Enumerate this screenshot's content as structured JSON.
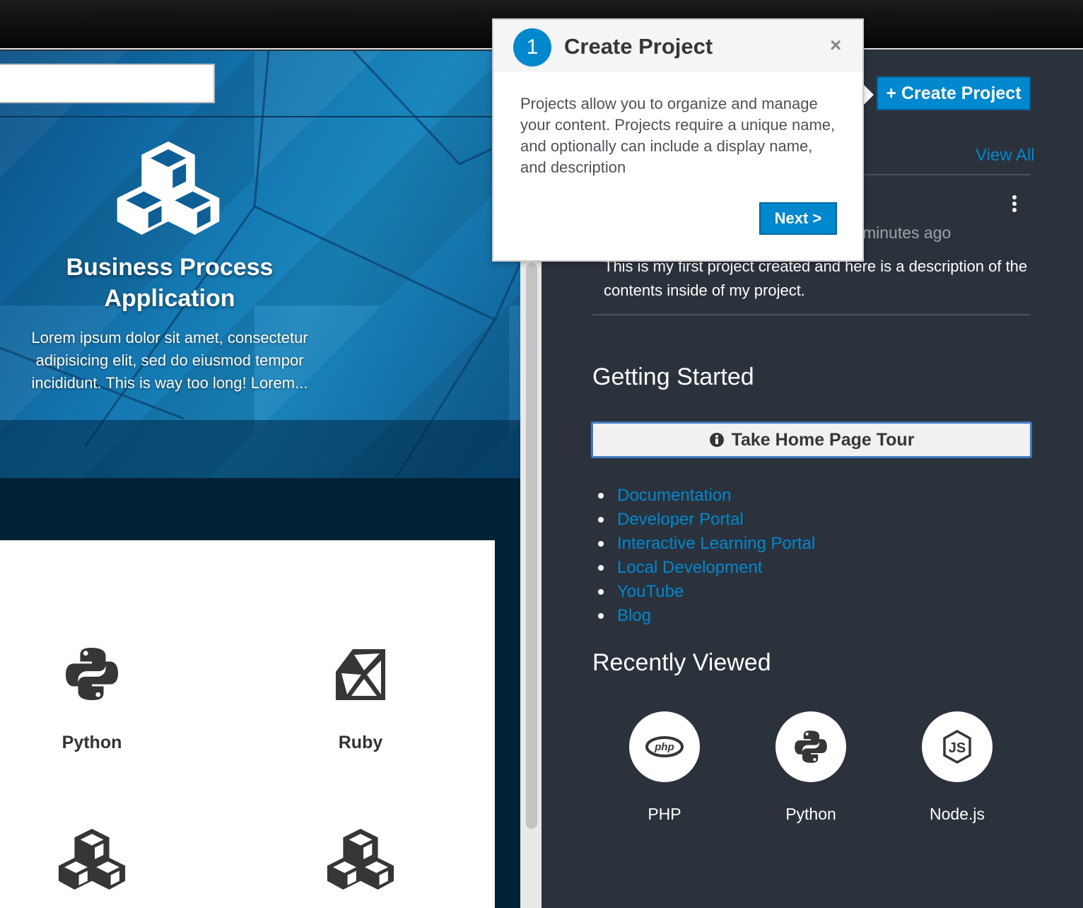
{
  "hero": {
    "title_line1": "Business Process",
    "title_line2": "Application",
    "description": "Lorem ipsum dolor sit amet, consectetur adipisicing elit, sed do eiusmod tempor incididunt. This is way too long! Lorem..."
  },
  "catalog": {
    "tiles": [
      {
        "label": "Python",
        "icon": "python-icon"
      },
      {
        "label": "Ruby",
        "icon": "ruby-icon"
      },
      {
        "label": "",
        "icon": "cubes-icon"
      },
      {
        "label": "",
        "icon": "cubes-icon"
      }
    ]
  },
  "tour_popover": {
    "step": "1",
    "title": "Create Project",
    "close": "×",
    "body": "Projects allow you to organize and manage your content. Projects require a unique name, and optionally can include a display name, and description",
    "next_label": "Next >"
  },
  "projects": {
    "create_label": "Create Project",
    "view_all": "View All",
    "item": {
      "time": "minutes ago",
      "description": "This is my first project created and here is a description of the contents inside of my project."
    }
  },
  "getting_started": {
    "title": "Getting Started",
    "tour_button": "Take Home Page Tour",
    "links": [
      "Documentation",
      "Developer Portal",
      "Interactive Learning Portal",
      "Local Development",
      "YouTube",
      "Blog"
    ]
  },
  "recently_viewed": {
    "title": "Recently Viewed",
    "items": [
      {
        "label": "PHP",
        "icon": "php-icon"
      },
      {
        "label": "Python",
        "icon": "python-icon"
      },
      {
        "label": "Node.js",
        "icon": "nodejs-icon"
      }
    ]
  },
  "colors": {
    "accent": "#0088ce",
    "panel_bg": "#2b323c",
    "top_bar": "#0a0a0a"
  }
}
